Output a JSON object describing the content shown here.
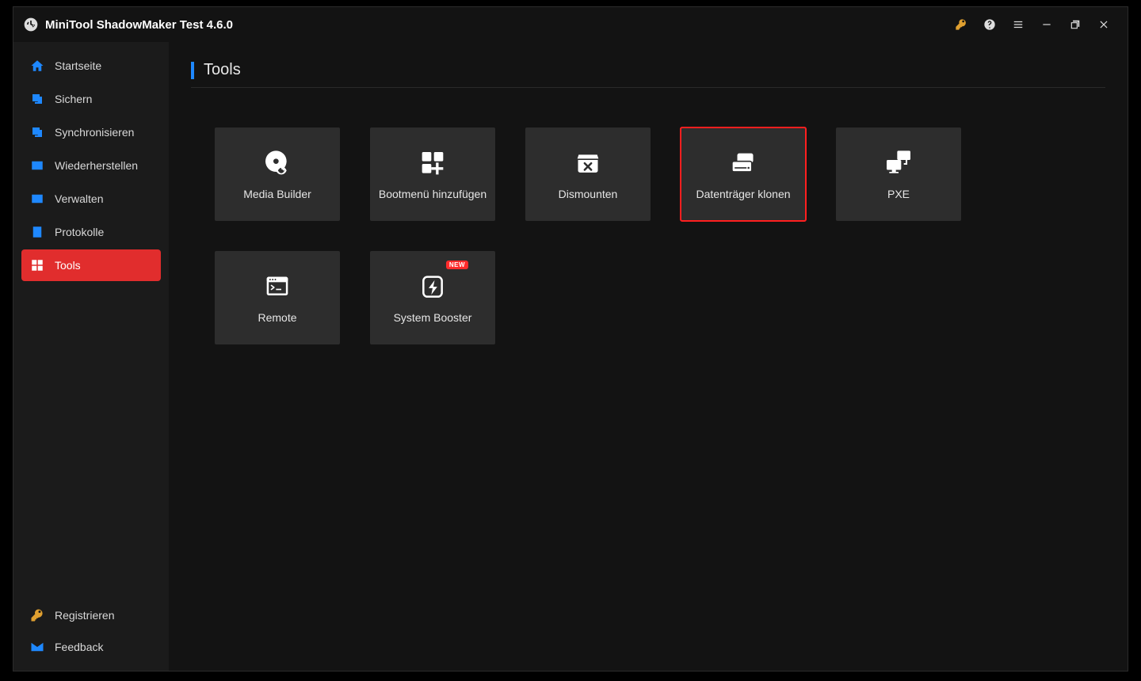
{
  "app": {
    "title": "MiniTool ShadowMaker Test 4.6.0"
  },
  "sidebar": {
    "items": [
      {
        "label": "Startseite"
      },
      {
        "label": "Sichern"
      },
      {
        "label": "Synchronisieren"
      },
      {
        "label": "Wiederherstellen"
      },
      {
        "label": "Verwalten"
      },
      {
        "label": "Protokolle"
      },
      {
        "label": "Tools"
      }
    ],
    "bottom": [
      {
        "label": "Registrieren"
      },
      {
        "label": "Feedback"
      }
    ]
  },
  "page": {
    "title": "Tools"
  },
  "tools": {
    "items": [
      {
        "label": "Media Builder"
      },
      {
        "label": "Bootmenü hinzufügen"
      },
      {
        "label": "Dismounten"
      },
      {
        "label": "Datenträger klonen"
      },
      {
        "label": "PXE"
      },
      {
        "label": "Remote"
      },
      {
        "label": "System Booster",
        "badge": "NEW"
      }
    ],
    "selectedIndex": 3
  }
}
